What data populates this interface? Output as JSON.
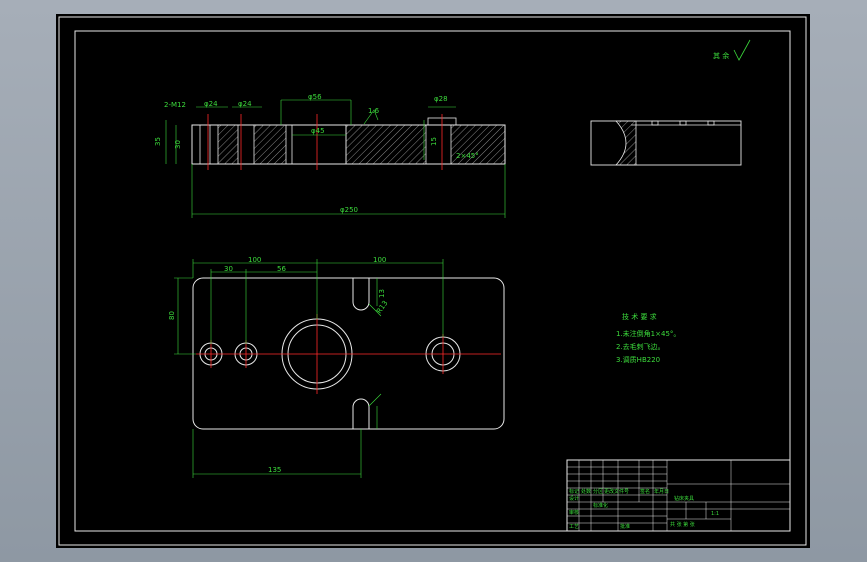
{
  "surface_mark": "其 余",
  "front_view": {
    "dims": {
      "holes": "2-M12",
      "d24a": "φ24",
      "d24b": "φ24",
      "d56": "φ56",
      "d28": "φ28",
      "d45": "φ45",
      "d250": "φ250",
      "h35": "35",
      "h30": "30",
      "h15": "15",
      "rough16": "1.6",
      "chamfer": "2×45°"
    }
  },
  "top_view": {
    "dims": {
      "d100a": "100",
      "d30": "30",
      "d56": "56",
      "d100b": "100",
      "d80": "80",
      "d135": "135",
      "slot_r": "R13",
      "slot_w": "13"
    }
  },
  "tech_requirements": {
    "title": "技 术 要 求",
    "items": [
      "1.未注倒角1×45°。",
      "2.去毛刺飞边。",
      "3.调质HB220"
    ]
  },
  "title_block": {
    "part_name": "钻床夹具",
    "scale": "1:1",
    "labels": [
      "标记",
      "处数",
      "分区",
      "更改文件号",
      "签名",
      "年月日",
      "设计",
      "审核",
      "工艺",
      "标准化",
      "批准",
      "共 张 第 张"
    ]
  }
}
